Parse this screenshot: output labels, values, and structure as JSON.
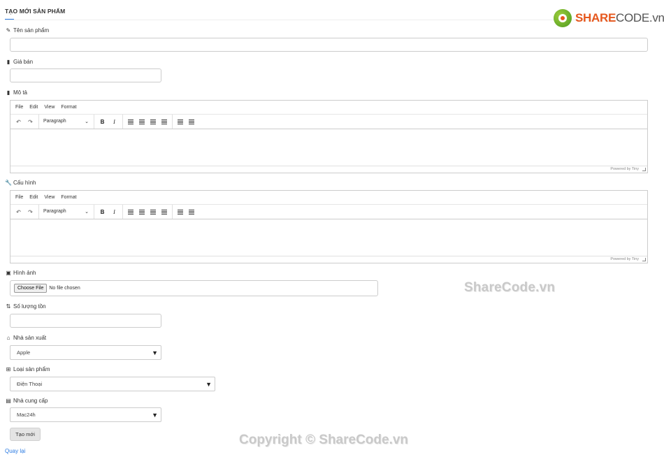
{
  "page": {
    "title": "TẠO MỚI SẢN PHẨM"
  },
  "logo": {
    "part1": "SHARE",
    "part2": "CODE.vn"
  },
  "fields": {
    "name": {
      "label": "Tên sản phẩm",
      "value": ""
    },
    "price": {
      "label": "Giá bán",
      "value": ""
    },
    "description": {
      "label": "Mô tả"
    },
    "config": {
      "label": "Cấu hình"
    },
    "image": {
      "label": "Hình ảnh",
      "button": "Choose File",
      "status": "No file chosen"
    },
    "stock": {
      "label": "Số lượng tồn",
      "value": ""
    },
    "manufacturer": {
      "label": "Nhà sản xuất",
      "selected": "Apple"
    },
    "category": {
      "label": "Loại sản phẩm",
      "selected": "Điện Thoại"
    },
    "supplier": {
      "label": "Nhà cung cấp",
      "selected": "Mac24h"
    }
  },
  "editor": {
    "menu": [
      "File",
      "Edit",
      "View",
      "Format"
    ],
    "block_format": "Paragraph",
    "powered_by": "Powered by Tiny"
  },
  "actions": {
    "submit": "Tạo mới",
    "back": "Quay lại"
  },
  "watermarks": {
    "center": "ShareCode.vn",
    "copyright": "Copyright © ShareCode.vn"
  },
  "icons": {
    "name": "edit-icon",
    "price": "file-icon",
    "description": "file-icon",
    "config": "wrench-icon",
    "image": "images-icon",
    "stock": "sort-icon",
    "manufacturer": "store-icon",
    "category": "sitemap-icon",
    "supplier": "warehouse-icon"
  },
  "colors": {
    "accent": "#2a7ae2",
    "logo_orange": "#e6581e",
    "logo_green": "#4c9a1f"
  }
}
